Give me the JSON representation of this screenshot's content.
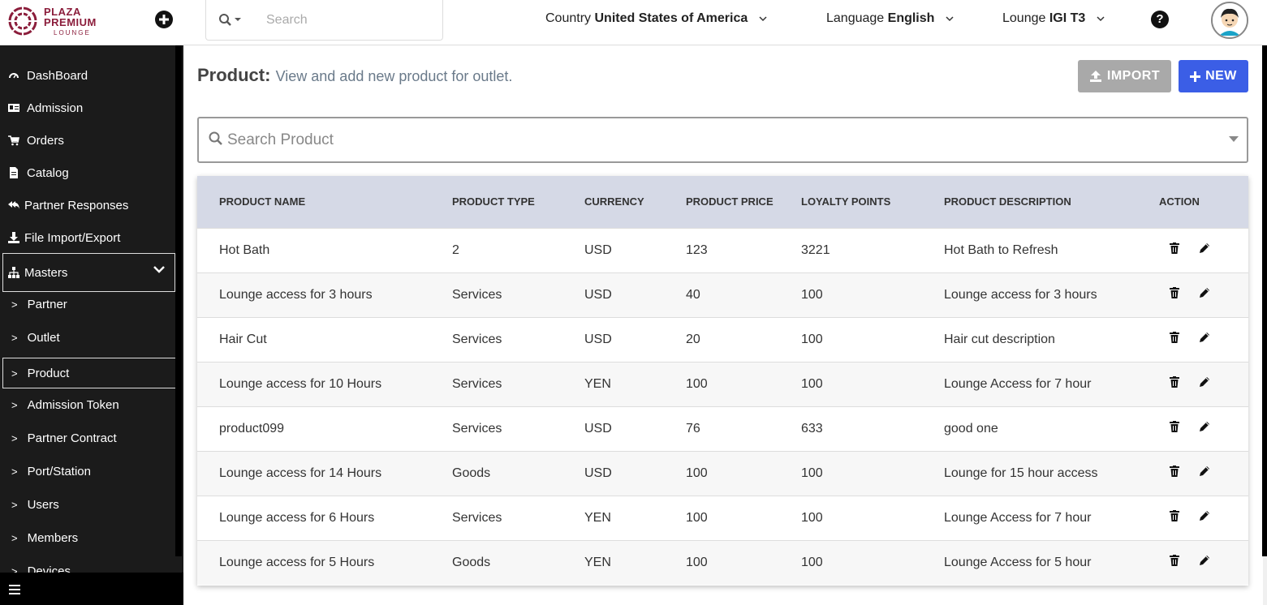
{
  "header": {
    "logo": {
      "line1": "PLAZA",
      "line2": "PREMIUM",
      "line3": "LOUNGE"
    },
    "search_placeholder": "Search",
    "country": {
      "label": "Country",
      "value": "United States of America"
    },
    "language": {
      "label": "Language",
      "value": "English"
    },
    "lounge": {
      "label": "Lounge",
      "value": "IGI T3"
    },
    "help_glyph": "?"
  },
  "sidebar": {
    "items": [
      {
        "label": "DashBoard",
        "icon": "dashboard-icon"
      },
      {
        "label": "Admission",
        "icon": "id-card-icon"
      },
      {
        "label": "Orders",
        "icon": "cart-icon"
      },
      {
        "label": "Catalog",
        "icon": "document-icon"
      },
      {
        "label": "Partner Responses",
        "icon": "reply-all-icon"
      },
      {
        "label": "File Import/Export",
        "icon": "download-icon"
      },
      {
        "label": "Masters",
        "icon": "sitemap-icon"
      }
    ],
    "sub_items": [
      {
        "label": "Partner"
      },
      {
        "label": "Outlet"
      },
      {
        "label": "Product"
      },
      {
        "label": "Admission Token"
      },
      {
        "label": "Partner Contract"
      },
      {
        "label": "Port/Station"
      },
      {
        "label": "Users"
      },
      {
        "label": "Members"
      },
      {
        "label": "Devices"
      }
    ]
  },
  "main": {
    "title": "Product:",
    "description": "View and add new product for outlet.",
    "import_label": "IMPORT",
    "new_label": "NEW",
    "search_placeholder": "Search Product",
    "table": {
      "headers": [
        "PRODUCT NAME",
        "PRODUCT TYPE",
        "CURRENCY",
        "PRODUCT PRICE",
        "LOYALTY POINTS",
        "PRODUCT DESCRIPTION",
        "ACTION"
      ],
      "rows": [
        [
          "Hot Bath",
          "2",
          "USD",
          "123",
          "3221",
          "Hot Bath to Refresh"
        ],
        [
          "Lounge access for 3 hours",
          "Services",
          "USD",
          "40",
          "100",
          "Lounge access for 3 hours"
        ],
        [
          "Hair Cut",
          "Services",
          "USD",
          "20",
          "100",
          "Hair cut description"
        ],
        [
          "Lounge access for 10 Hours",
          "Services",
          "YEN",
          "100",
          "100",
          "Lounge Access for 7 hour"
        ],
        [
          "product099",
          "Services",
          "USD",
          "76",
          "633",
          "good one"
        ],
        [
          "Lounge access for 14 Hours",
          "Goods",
          "USD",
          "100",
          "100",
          "Lounge for 15 hour access"
        ],
        [
          "Lounge access for 6 Hours",
          "Services",
          "YEN",
          "100",
          "100",
          "Lounge Access for 7 hour"
        ],
        [
          "Lounge access for 5 Hours",
          "Goods",
          "YEN",
          "100",
          "100",
          "Lounge Access for 5 hour"
        ]
      ]
    }
  },
  "colors": {
    "brand": "#8b1d3b",
    "new_button": "#3b5ee6",
    "import_button": "#a9a9a9",
    "table_header": "#d5d9e6",
    "sidebar_bg": "#1b1b1b"
  }
}
